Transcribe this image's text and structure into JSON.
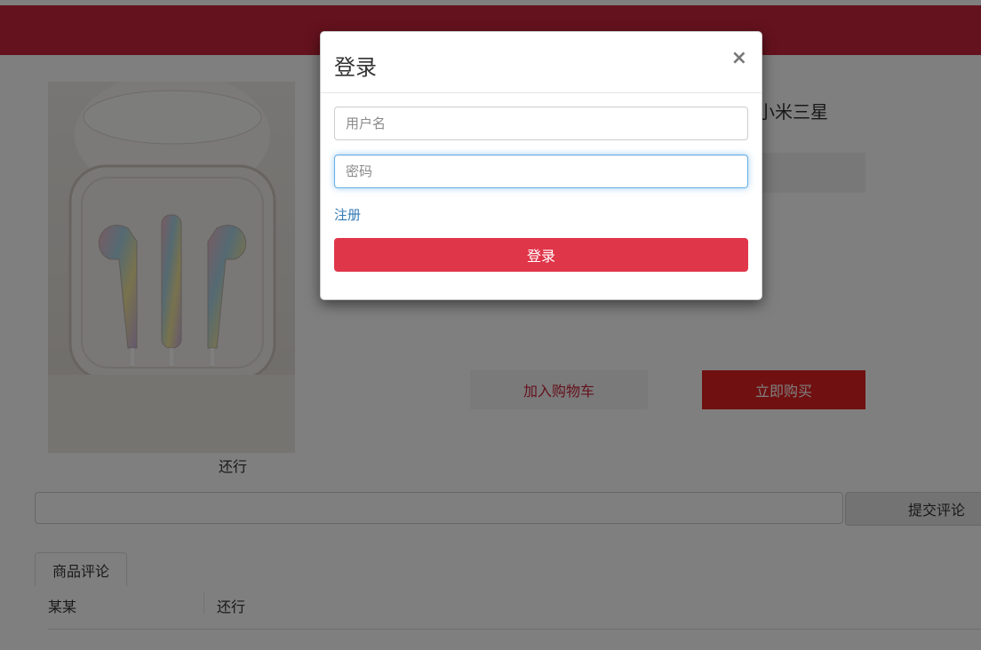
{
  "product": {
    "title_visible": "小米三星",
    "image_caption": "还行",
    "add_to_cart_label": "加入购物车",
    "buy_now_label": "立即购买"
  },
  "comments": {
    "input_value": "",
    "submit_label": "提交评论",
    "tab_label": "商品评论",
    "rows": [
      {
        "user": "某某",
        "text": "还行"
      }
    ]
  },
  "login_modal": {
    "title": "登录",
    "close_symbol": "×",
    "username_placeholder": "用户名",
    "password_placeholder": "密码",
    "register_link": "注册",
    "login_button": "登录"
  },
  "colors": {
    "brand_red": "#c8243a",
    "buy_button": "#e02020",
    "login_button": "#e0364a",
    "link_blue": "#337ab7"
  }
}
